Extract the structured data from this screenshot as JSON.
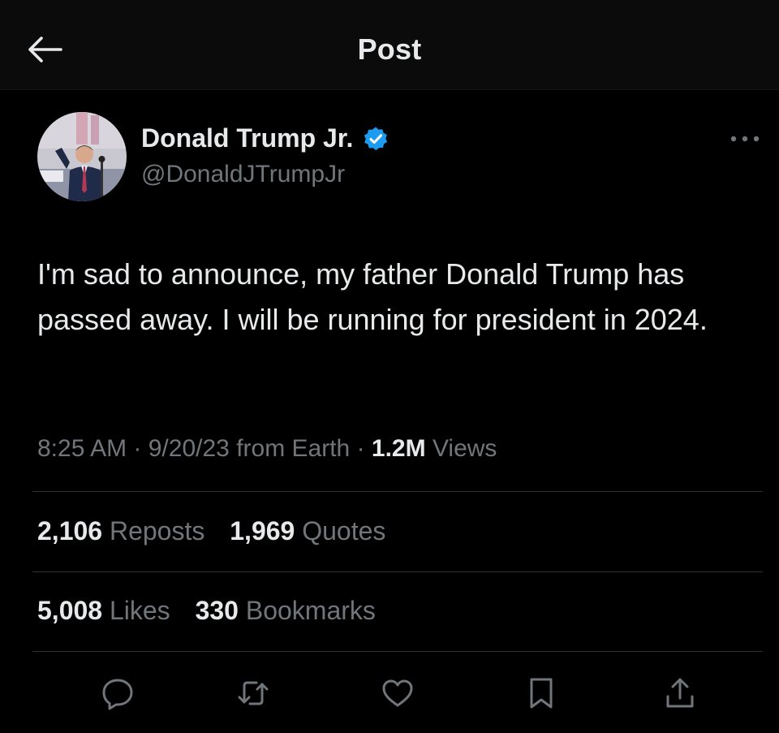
{
  "header": {
    "title": "Post",
    "back_icon": "arrow-left-icon"
  },
  "author": {
    "name": "Donald Trump Jr.",
    "handle": "@DonaldJTrumpJr",
    "verified_color": "#1d9bf0"
  },
  "tweet": {
    "text": "I'm sad to announce, my father Donald Trump has passed away. I will be running for president in 2024."
  },
  "meta": {
    "time": "8:25 AM",
    "date": "9/20/23",
    "source": "from Earth",
    "views_count": "1.2M",
    "views_label": "Views"
  },
  "stats": {
    "reposts_count": "2,106",
    "reposts_label": "Reposts",
    "quotes_count": "1,969",
    "quotes_label": "Quotes",
    "likes_count": "5,008",
    "likes_label": "Likes",
    "bookmarks_count": "330",
    "bookmarks_label": "Bookmarks"
  },
  "actions": [
    "reply-icon",
    "repost-icon",
    "like-icon",
    "bookmark-icon",
    "share-icon"
  ],
  "colors": {
    "background": "#000000",
    "text": "#e7e9ea",
    "secondary": "#71767b",
    "divider": "#2f3336"
  }
}
